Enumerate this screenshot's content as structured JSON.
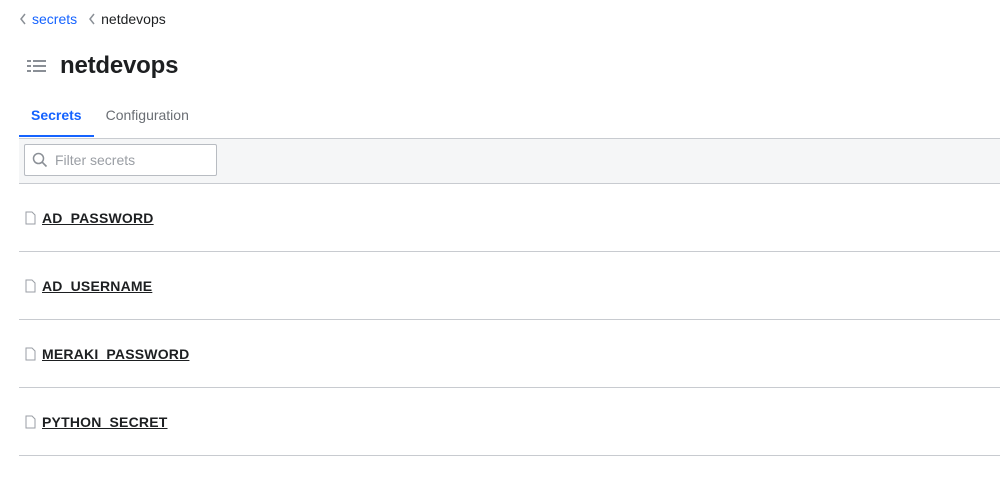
{
  "breadcrumb": {
    "items": [
      {
        "label": "secrets"
      },
      {
        "label": "netdevops"
      }
    ]
  },
  "page": {
    "title": "netdevops"
  },
  "tabs": [
    {
      "label": "Secrets",
      "active": true
    },
    {
      "label": "Configuration",
      "active": false
    }
  ],
  "filter": {
    "placeholder": "Filter secrets",
    "value": ""
  },
  "secrets": [
    {
      "name": " AD_PASSWORD"
    },
    {
      "name": " AD_USERNAME"
    },
    {
      "name": " MERAKI_PASSWORD"
    },
    {
      "name": " PYTHON_SECRET"
    }
  ],
  "colors": {
    "accent": "#1563ff",
    "border": "#c8cbd0",
    "toolbar_bg": "#f5f6f7"
  },
  "icons": {
    "page": "list-icon",
    "search": "search-icon",
    "row": "file-icon",
    "breadcrumb": "chevron-left-icon"
  }
}
